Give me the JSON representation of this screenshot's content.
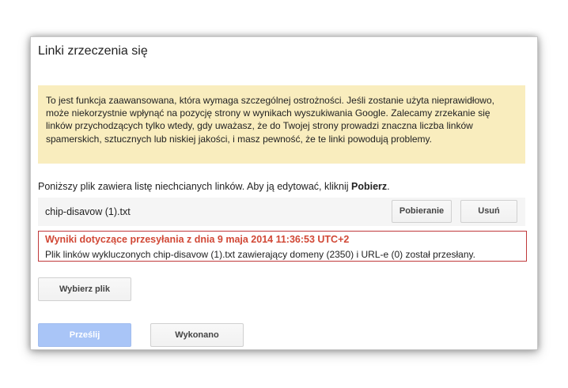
{
  "dialog": {
    "title": "Linki zrzeczenia się",
    "warning": "To jest funkcja zaawansowana, która wymaga szczególnej ostrożności. Jeśli zostanie użyta nieprawidłowo, może niekorzystnie wpłynąć na pozycję strony w wynikach wyszukiwania Google. Zalecamy zrzekanie się linków przychodzących tylko wtedy, gdy uważasz, że do Twojej strony prowadzi znaczna liczba linków spamerskich, sztucznych lub niskiej jakości, i masz pewność, że te linki powodują problemy.",
    "instruction_prefix": "Poniższy plik zawiera listę niechcianych linków. Aby ją edytować, kliknij ",
    "instruction_bold": "Pobierz",
    "instruction_suffix": ".",
    "file": {
      "name": "chip-disavow (1).txt",
      "download_label": "Pobieranie",
      "delete_label": "Usuń"
    },
    "result": {
      "title": "Wyniki dotyczące przesyłania z dnia 9 maja 2014 11:36:53 UTC+2",
      "text": "Plik linków wykluczonych chip-disavow (1).txt zawierający domeny (2350) i URL-e (0) został przesłany."
    },
    "choose_file_label": "Wybierz plik",
    "submit_label": "Prześlij",
    "done_label": "Wykonano"
  },
  "colors": {
    "warning_background": "#f9edbe",
    "result_border": "#c0393b",
    "result_title": "#d14836",
    "submit_disabled": "#a9c5f7"
  }
}
